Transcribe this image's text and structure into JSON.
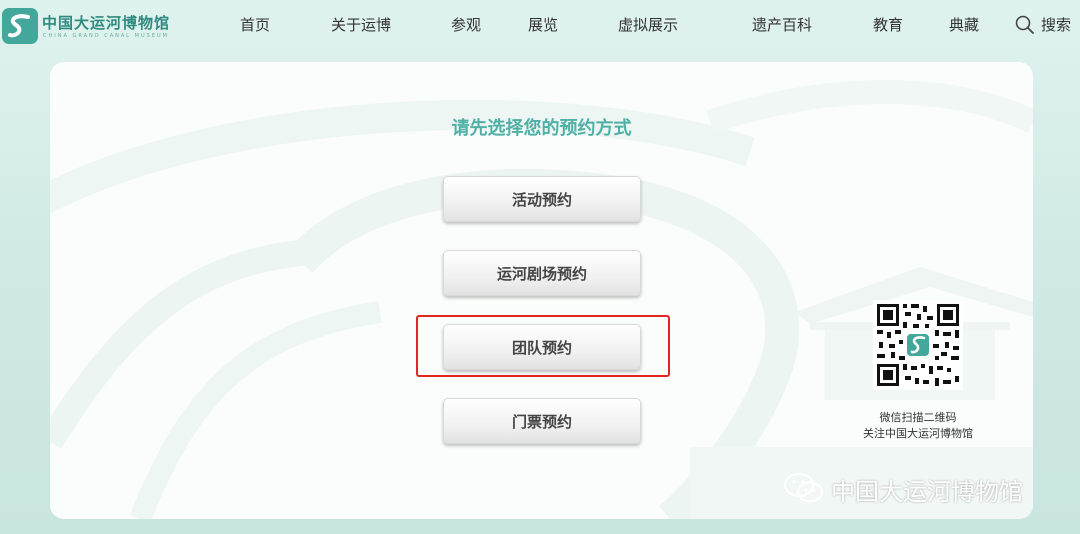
{
  "header": {
    "logo_cn": "中国大运河博物馆",
    "logo_en": "CHINA GRAND CANAL MUSEUM",
    "nav": [
      {
        "label": "首页"
      },
      {
        "label": "关于运博"
      },
      {
        "label": "参观"
      },
      {
        "label": "展览"
      },
      {
        "label": "虚拟展示"
      },
      {
        "label": "遗产百科"
      },
      {
        "label": "教育"
      },
      {
        "label": "典藏"
      }
    ],
    "search_label": "搜索"
  },
  "main": {
    "heading": "请先选择您的预约方式",
    "buttons": [
      {
        "label": "活动预约"
      },
      {
        "label": "运河剧场预约"
      },
      {
        "label": "团队预约"
      },
      {
        "label": "门票预约"
      }
    ],
    "highlighted_button": "团队预约",
    "qr_caption_line1": "微信扫描二维码",
    "qr_caption_line2": "关注中国大运河博物馆"
  },
  "watermark": {
    "text": "中国大运河博物馆",
    "icon": "wechat-icon"
  },
  "colors": {
    "accent": "#4fb0a5",
    "logo": "#43a79c",
    "highlight_border": "#e0261e",
    "page_bg": "#d4ece7"
  }
}
